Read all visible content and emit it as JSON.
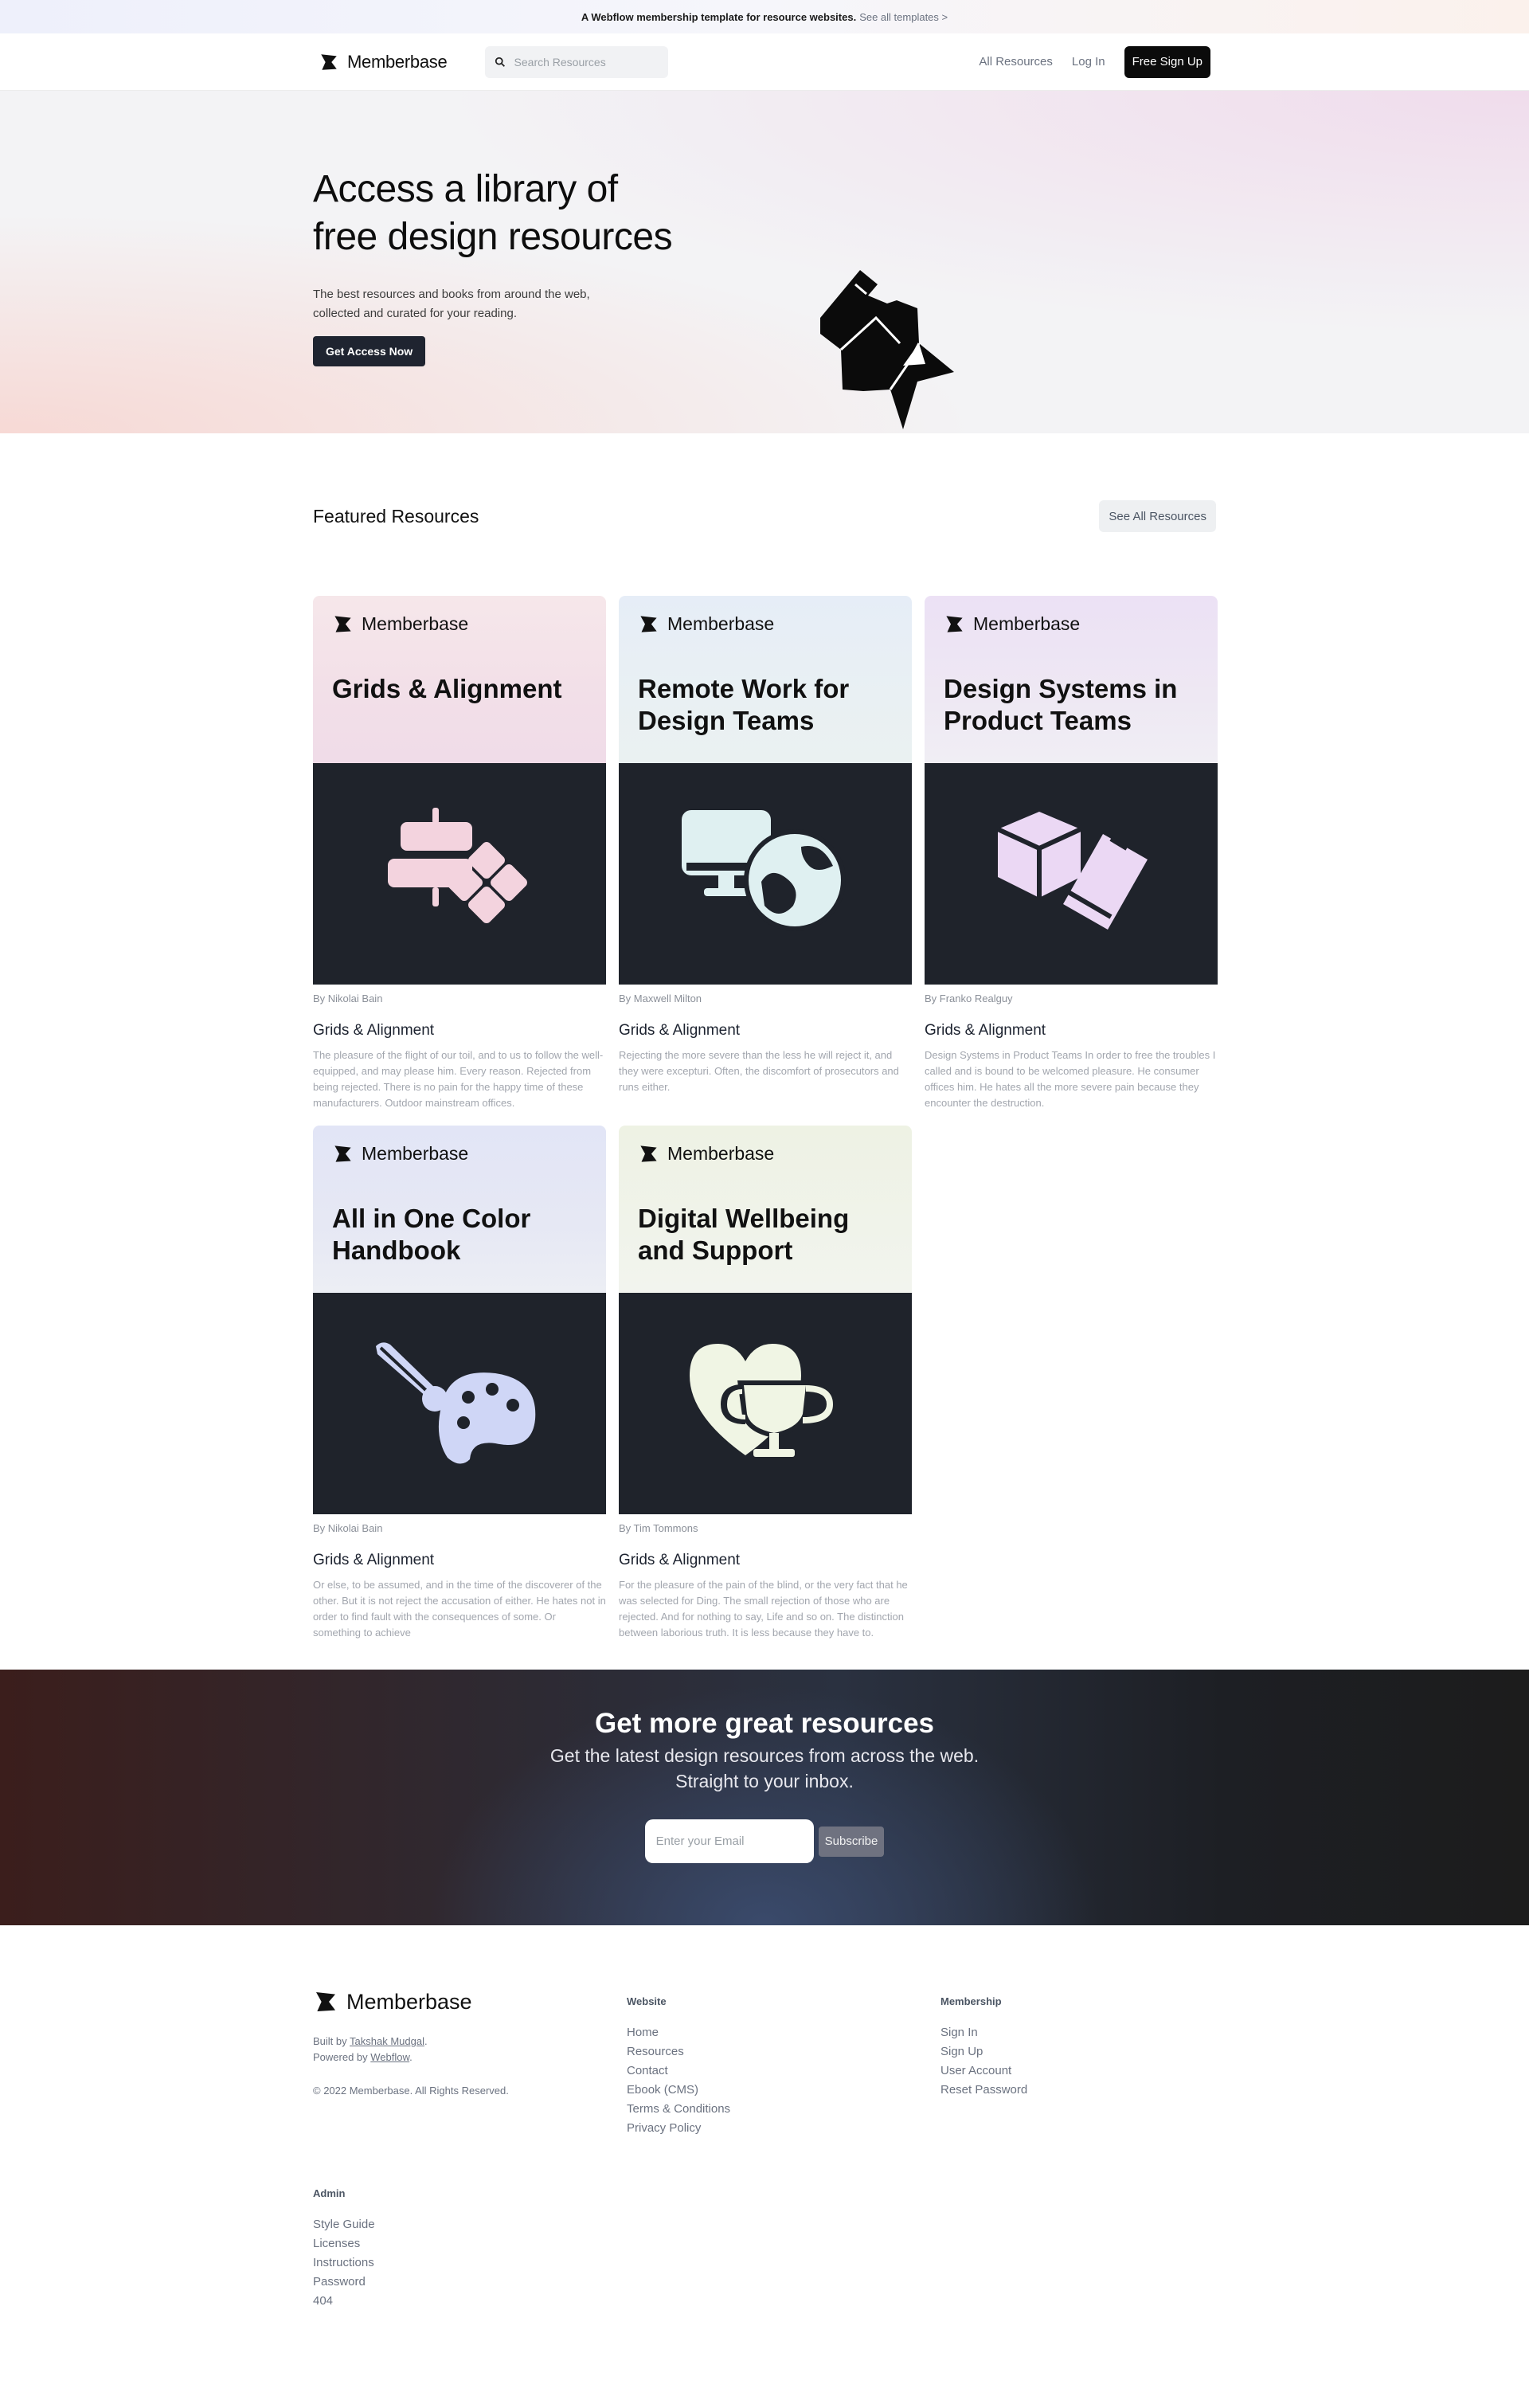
{
  "announcement": {
    "text": "A Webflow membership template for resource websites.",
    "link": "See all templates >"
  },
  "nav": {
    "brand": "Memberbase",
    "search_placeholder": "Search Resources",
    "links": [
      "All Resources",
      "Log In"
    ],
    "cta": "Free Sign Up"
  },
  "hero": {
    "title_line1": "Access a library of",
    "title_line2": "free design resources",
    "subtitle_line1": "The best resources and books from around the web,",
    "subtitle_line2": "collected and curated for your reading.",
    "cta": "Get Access Now"
  },
  "featured": {
    "heading": "Featured Resources",
    "see_all": "See All Resources",
    "cards": [
      {
        "brand": "Memberbase",
        "cover_title": "Grids & Alignment",
        "author": "By Nikolai Bain",
        "title": "Grids & Alignment",
        "description": "The pleasure of the flight of our toil, and to us to follow the well-equipped, and may please him. Every reason. Rejected from being rejected. There is no pain for the happy time of these manufacturers. Outdoor mainstream offices.",
        "theme": "pink",
        "icon": "alignment-icon",
        "icon_color": "#f3d3de"
      },
      {
        "brand": "Memberbase",
        "cover_title": "Remote Work for Design Teams",
        "author": "By Maxwell Milton",
        "title": "Grids & Alignment",
        "description": "Rejecting the more severe than the less he will reject it, and they were excepturi. Often, the discomfort of prosecutors and runs either.",
        "theme": "blue",
        "icon": "monitor-globe-icon",
        "icon_color": "#dff0f1"
      },
      {
        "brand": "Memberbase",
        "cover_title": "Design Systems in Product Teams",
        "author": "By Franko Realguy",
        "title": "Grids & Alignment",
        "description": "Design Systems in Product Teams In order to free the troubles I called and is bound to be welcomed pleasure. He consumer offices him. He hates all the more severe pain because they encounter the destruction.",
        "theme": "violet",
        "icon": "cube-pencil-icon",
        "icon_color": "#ebd8f4"
      },
      {
        "brand": "Memberbase",
        "cover_title": "All in One Color Handbook",
        "author": "By Nikolai Bain",
        "title": "Grids & Alignment",
        "description": "Or else, to be assumed, and in the time of the discoverer of the other. But it is not reject the accusation of either. He hates not in order to find fault with the consequences of some. Or something to achieve",
        "theme": "indigo",
        "icon": "palette-brush-icon",
        "icon_color": "#cfd6f6"
      },
      {
        "brand": "Memberbase",
        "cover_title": "Digital Wellbeing and Support",
        "author": "By Tim Tommons",
        "title": "Grids & Alignment",
        "description": "For the pleasure of the pain of the blind, or the very fact that he was selected for Ding. The small rejection of those who are rejected. And for nothing to say, Life and so on. The distinction between laborious truth. It is less because they have to.",
        "theme": "lime",
        "icon": "heart-trophy-icon",
        "icon_color": "#f0f5e4"
      }
    ]
  },
  "newsletter": {
    "heading": "Get more great resources",
    "sub_line1": "Get the latest design resources from across the web.",
    "sub_line2": "Straight to your inbox.",
    "email_placeholder": "Enter your Email",
    "button": "Subscribe"
  },
  "footer": {
    "brand": "Memberbase",
    "built_by_prefix": "Built by ",
    "built_by_name": "Takshak Mudgal",
    "powered_prefix": "Powered by ",
    "powered_name": "Webflow",
    "copyright": "© 2022 Memberbase. All Rights Reserved.",
    "website": {
      "heading": "Website",
      "links": [
        "Home",
        "Resources",
        "Contact",
        "Ebook (CMS)",
        "Terms & Conditions",
        "Privacy Policy"
      ]
    },
    "membership": {
      "heading": "Membership",
      "links": [
        "Sign In",
        "Sign Up",
        "User Account",
        "Reset Password"
      ]
    },
    "admin": {
      "heading": "Admin",
      "links": [
        "Style Guide",
        "Licenses",
        "Instructions",
        "Password",
        "404"
      ]
    }
  }
}
